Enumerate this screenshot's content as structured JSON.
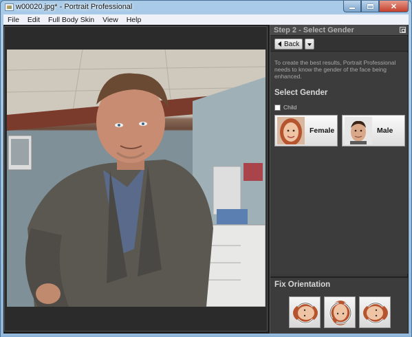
{
  "window": {
    "title": "w00020.jpg* - Portrait Professional",
    "minimize_label": "",
    "maximize_label": "",
    "close_label": "✕"
  },
  "menu": [
    "File",
    "Edit",
    "Full Body Skin",
    "View",
    "Help"
  ],
  "panel": {
    "header": "Step 2 - Select Gender",
    "back_label": "Back",
    "info_text": "To create the best results, Portrait Professional needs to know the gender of the face being enhanced.",
    "select_gender_title": "Select Gender",
    "child_label": "Child",
    "child_checked": false,
    "female_label": "Female",
    "male_label": "Male",
    "orientation_title": "Fix Orientation"
  },
  "colors": {
    "panel_bg": "#3c3c3c",
    "client_bg": "#202020",
    "titlebar_blue": "#a9cbe8",
    "close_red": "#c4402c"
  },
  "icons": [
    "app-icon",
    "back-arrow-icon",
    "dropdown-arrow-icon",
    "panel-restore-icon",
    "rotate-left-icon",
    "rotate-180-icon",
    "rotate-right-icon"
  ]
}
